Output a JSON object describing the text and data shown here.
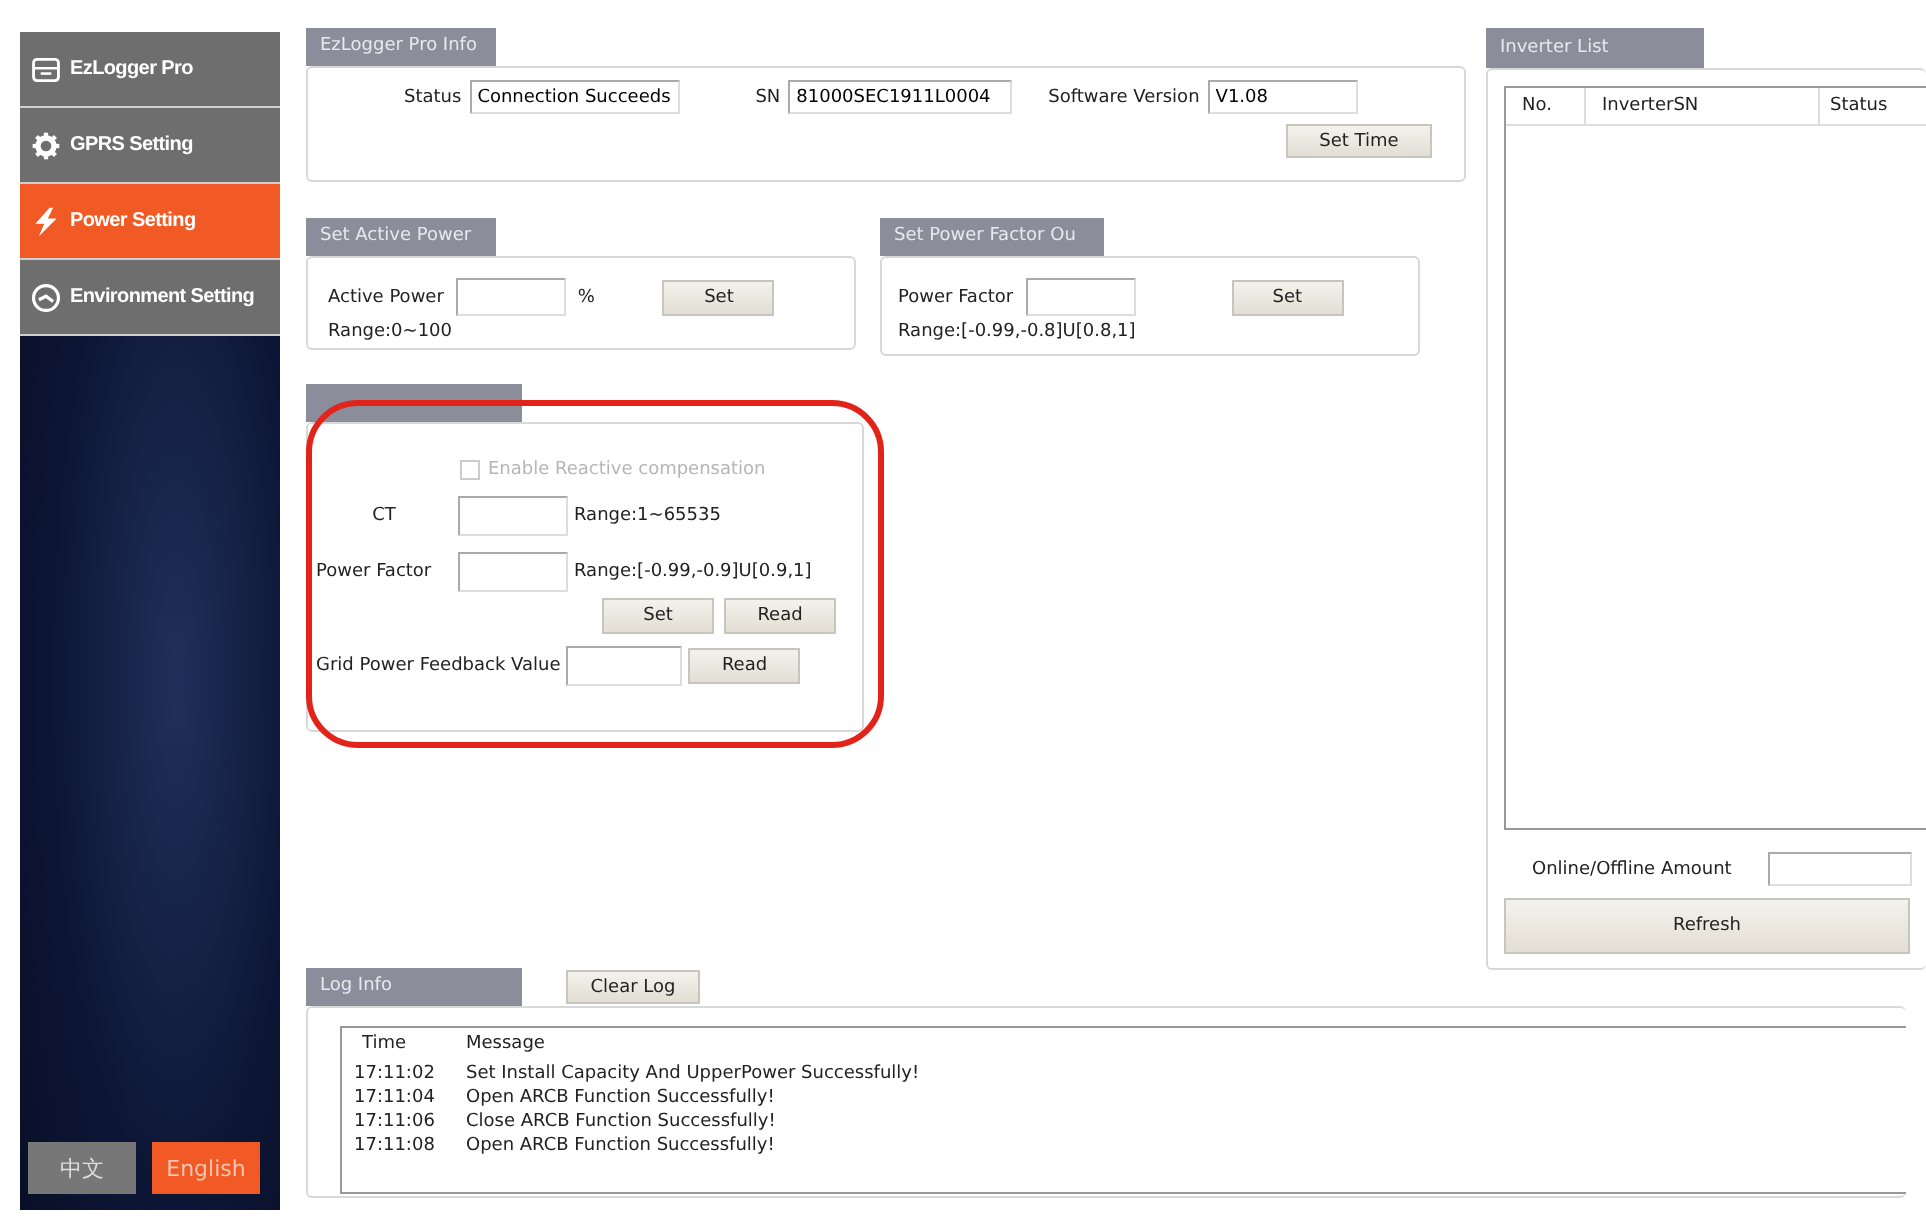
{
  "sidebar": {
    "items": [
      {
        "label": "EzLogger Pro",
        "selected": false
      },
      {
        "label": "GPRS Setting",
        "selected": false
      },
      {
        "label": "Power Setting",
        "selected": true
      },
      {
        "label": "Environment Setting",
        "selected": false
      }
    ],
    "languages": [
      {
        "label": "中文",
        "selected": false
      },
      {
        "label": "English",
        "selected": true
      }
    ]
  },
  "info_panel": {
    "title": "EzLogger Pro Info",
    "fields": [
      {
        "label": "Status",
        "value": "Connection Succeeds"
      },
      {
        "label": "SN",
        "value": "81000SEC1911L0004"
      },
      {
        "label": "Software Version",
        "value": "V1.08"
      }
    ],
    "button": "Set Time"
  },
  "active_power": {
    "title": "Set Active Power",
    "label": "Active Power",
    "unit": "%",
    "button": "Set",
    "range": "Range:0~100"
  },
  "power_factor_output": {
    "title": "Set Power Factor Ou",
    "label": "Power Factor",
    "button": "Set",
    "range": "Range:[-0.99,-0.8]U[0.8,1]"
  },
  "reactive_panel": {
    "checkbox": {
      "label": "Enable Reactive compensation",
      "checked": false,
      "disabled": true
    },
    "ct": {
      "label": "CT",
      "range": "Range:1~65535"
    },
    "power_factor": {
      "label": "Power Factor",
      "range": "Range:[-0.99,-0.9]U[0.9,1]"
    },
    "buttons": [
      "Set",
      "Read"
    ],
    "feedback": {
      "label": "Grid Power Feedback Value",
      "button": "Read"
    }
  },
  "inverter_list": {
    "title": "Inverter List",
    "columns": [
      "No.",
      "InverterSN",
      "Status"
    ],
    "amount_label": "Online/Offline Amount",
    "button": "Refresh"
  },
  "log": {
    "title": "Log Info",
    "clear_button": "Clear Log",
    "columns": [
      "Time",
      "Message"
    ],
    "rows": [
      {
        "time": "17:11:02",
        "message": "Set Install Capacity And UpperPower Successfully!"
      },
      {
        "time": "17:11:04",
        "message": "Open ARCB Function Successfully!"
      },
      {
        "time": "17:11:06",
        "message": "Close ARCB Function Successfully!"
      },
      {
        "time": "17:11:08",
        "message": "Open ARCB Function Successfully!"
      }
    ]
  }
}
